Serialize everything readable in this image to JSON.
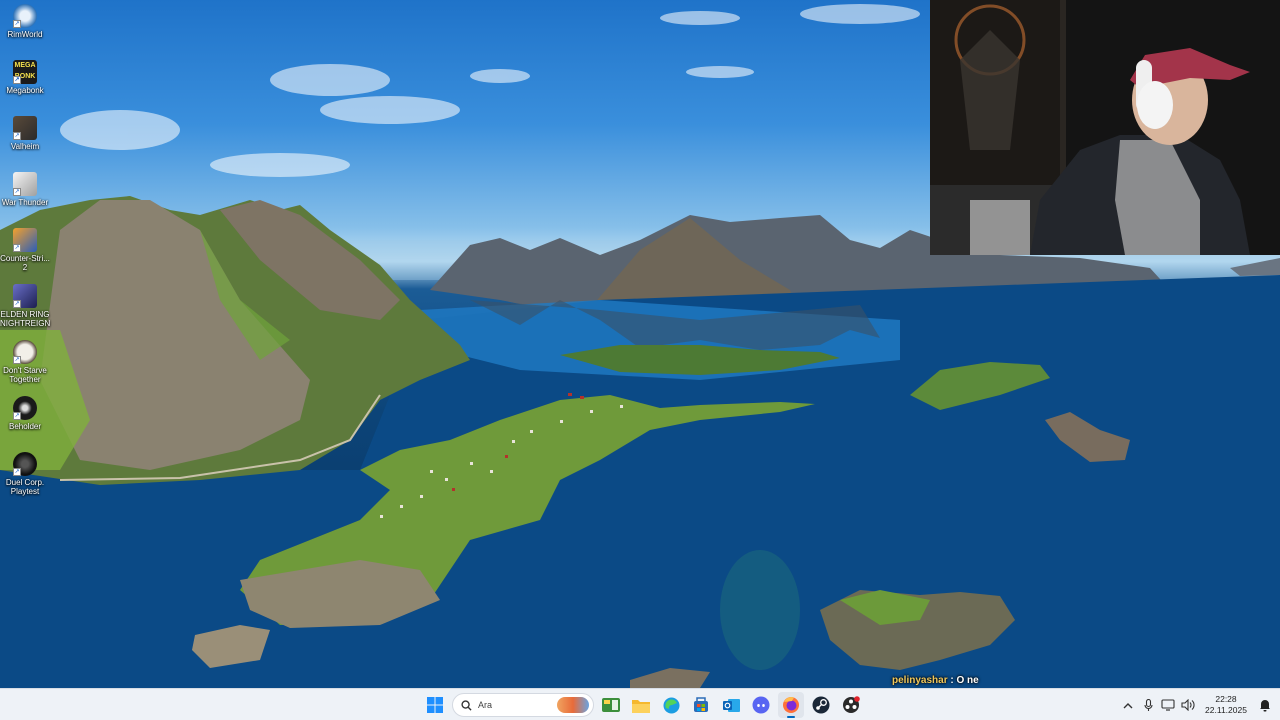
{
  "desktop": {
    "icons": [
      {
        "id": "rimworld",
        "label": "RimWorld",
        "icon": "rimworld-icon",
        "color": "#2b6fb4"
      },
      {
        "id": "megabonk",
        "label": "Megabonk",
        "icon": "megabonk-icon",
        "color": "#1b1b1b"
      },
      {
        "id": "valheim",
        "label": "Valheim",
        "icon": "valheim-icon",
        "color": "#3a3a3a"
      },
      {
        "id": "war-thunder",
        "label": "War Thunder",
        "icon": "war-thunder-icon",
        "color": "#d9d9d9"
      },
      {
        "id": "counter-strike",
        "label": "Counter-Stri...\n2",
        "icon": "counter-strike-icon",
        "color": "#2a5db8"
      },
      {
        "id": "elden-ring",
        "label": "ELDEN RING\nNIGHTREIGN",
        "icon": "elden-ring-icon",
        "color": "#3b3f8a"
      },
      {
        "id": "dont-starve",
        "label": "Don't Starve\nTogether",
        "icon": "dont-starve-icon",
        "color": "#f2efe8"
      },
      {
        "id": "beholder",
        "label": "Beholder",
        "icon": "beholder-icon",
        "color": "#1a1a1a"
      },
      {
        "id": "duel-corp",
        "label": "Duel Corp.\nPlaytest",
        "icon": "duel-corp-icon",
        "color": "#111111"
      }
    ]
  },
  "chat": {
    "username": "pelinyashar",
    "separator": " : ",
    "message": "O ne"
  },
  "taskbar": {
    "search_placeholder": "Ara",
    "apps": [
      {
        "name": "start-button",
        "icon": "windows-icon",
        "active": false
      },
      {
        "name": "widgets-button",
        "icon": "widgets-icon",
        "active": false
      },
      {
        "name": "file-explorer-button",
        "icon": "folder-icon",
        "active": false
      },
      {
        "name": "edge-button",
        "icon": "edge-icon",
        "active": false
      },
      {
        "name": "store-button",
        "icon": "store-icon",
        "active": false
      },
      {
        "name": "outlook-button",
        "icon": "outlook-icon",
        "active": false
      },
      {
        "name": "discord-button",
        "icon": "discord-icon",
        "active": false
      },
      {
        "name": "firefox-button",
        "icon": "firefox-icon",
        "active": true
      },
      {
        "name": "steam-button",
        "icon": "steam-icon",
        "active": false
      },
      {
        "name": "obs-button",
        "icon": "obs-icon",
        "active": false
      }
    ],
    "clock": {
      "time": "22:28",
      "date": "22.11.2025"
    }
  },
  "colors": {
    "accent": "#0067c0",
    "taskbar_bg": "#eef2f7",
    "chat_username": "#f0c75a"
  }
}
